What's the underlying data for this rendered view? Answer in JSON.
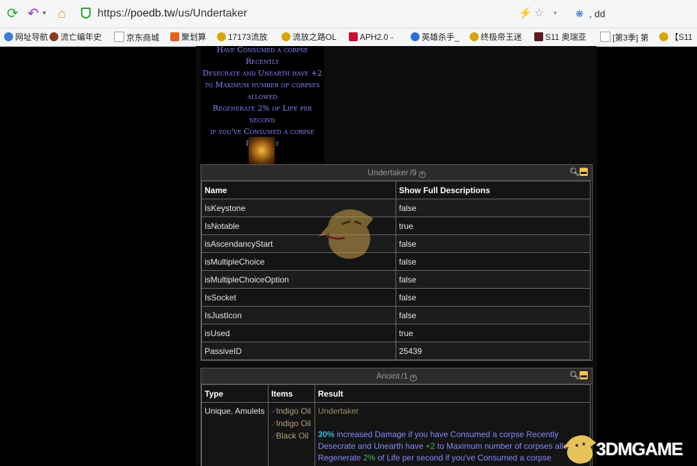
{
  "browser": {
    "url_prefix": "https://",
    "url_host": "poedb.tw",
    "url_path": "/us/Undertaker",
    "search_text": "dd",
    "bookmarks": [
      {
        "label": "网址导航",
        "color": "#3a7bd5"
      },
      {
        "label": "流亡编年史",
        "color": "#8b3a1a"
      },
      {
        "label": "京东商城",
        "color": "#d0d0d0"
      },
      {
        "label": "聚划算",
        "color": "#e8601c"
      },
      {
        "label": "17173流放",
        "color": "#d9a400"
      },
      {
        "label": "流放之路OL",
        "color": "#d9a400"
      },
      {
        "label": "APH2.0 -",
        "color": "#c8102e"
      },
      {
        "label": "英雄杀手_",
        "color": "#2a6fdb"
      },
      {
        "label": "终极帝王迷",
        "color": "#d9a400"
      },
      {
        "label": "S11 奥瑞亚",
        "color": "#5a1a1a"
      },
      {
        "label": "[第3季] 第",
        "color": "#d0d0d0"
      },
      {
        "label": "【S11",
        "color": "#d9a400"
      }
    ]
  },
  "tooltip": {
    "lines": [
      "Have Consumed a corpse",
      "Recently",
      "Desecrate and Unearth have +2",
      "to Maximum number of corpses",
      "allowed",
      "Regenerate 2% of Life per second",
      "if you've Consumed a corpse",
      "Recently"
    ]
  },
  "undertaker_panel": {
    "title": "Undertaker",
    "count": "/9",
    "headers": [
      "Name",
      "Show Full Descriptions"
    ],
    "rows": [
      [
        "IsKeystone",
        "false"
      ],
      [
        "IsNotable",
        "true"
      ],
      [
        "isAscendancyStart",
        "false"
      ],
      [
        "isMultipleChoice",
        "false"
      ],
      [
        "isMultipleChoiceOption",
        "false"
      ],
      [
        "IsSocket",
        "false"
      ],
      [
        "IsJustIcon",
        "false"
      ],
      [
        "isUsed",
        "true"
      ],
      [
        "PassiveID",
        "25439"
      ]
    ]
  },
  "anoint_panel": {
    "title": "Anoint",
    "count": "/1",
    "headers": [
      "Type",
      "Items",
      "Result"
    ],
    "type": "Unique, Amulets",
    "items": [
      "Indigo Oil",
      "Indigo Oil",
      "Black Oil"
    ],
    "result_title": "Undertaker",
    "result_lines": [
      {
        "num": "30%",
        "text": " increased Damage if you have Consumed a corpse Recently"
      },
      {
        "pre": "Desecrate and Unearth have ",
        "num": "+2",
        "text": " to Maximum number of corpses allowed"
      },
      {
        "pre": "Regenerate ",
        "num": "2%",
        "text": " of Life per second if you've Consumed a corpse"
      }
    ]
  },
  "watermark": {
    "text": "3DMGAME"
  }
}
